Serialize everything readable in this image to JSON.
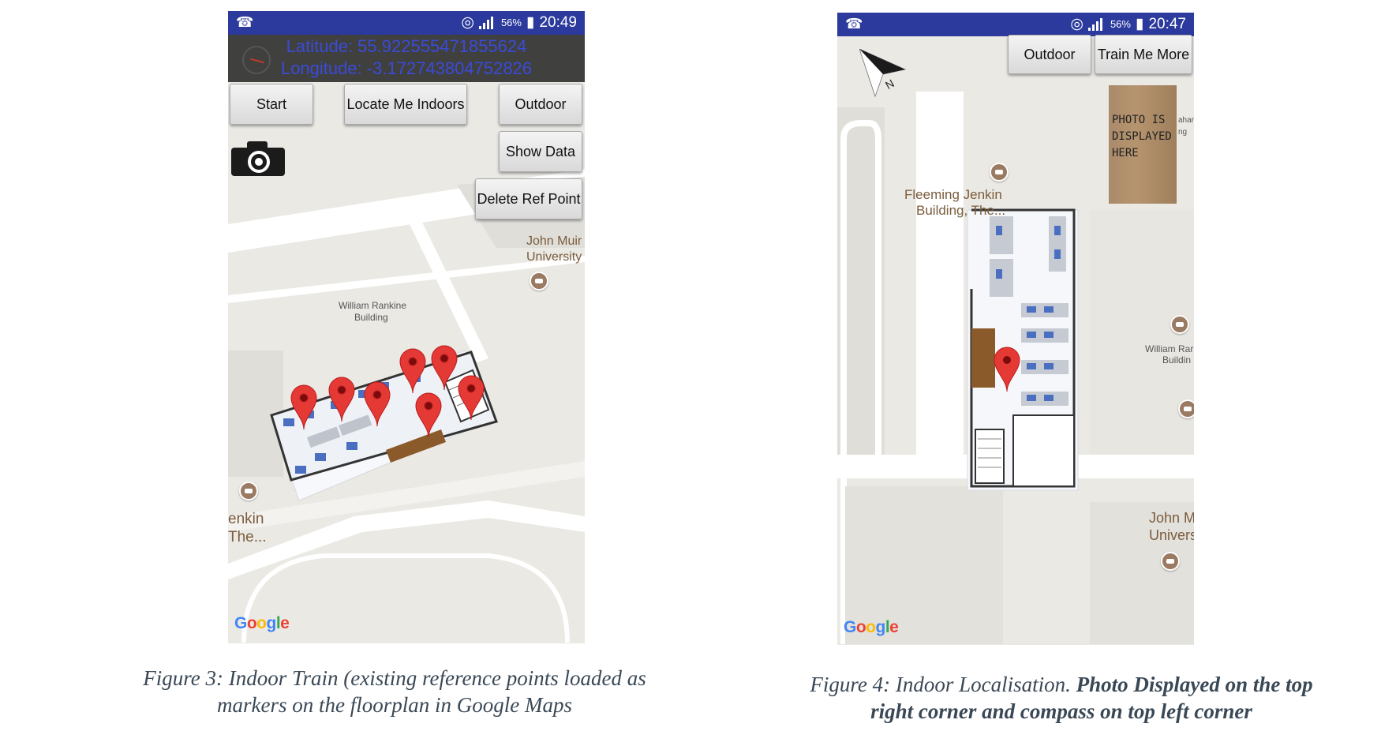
{
  "figure3": {
    "status": {
      "left_icon": "notification-icon",
      "battery_pct": "56%",
      "time": "20:49"
    },
    "latitude": "Latitude: 55.922555471855624",
    "longitude": "Longitude: -3.172743804752826",
    "buttons": {
      "start": "Start",
      "locate_indoors": "Locate Me Indoors",
      "outdoor": "Outdoor",
      "show_data": "Show Data",
      "delete_ref": "Delete Ref Point"
    },
    "map_labels": {
      "john_muir_1": "John Muir",
      "john_muir_2": "University",
      "rankine_1": "William Rankine",
      "rankine_2": "Building",
      "jenkin_1": "enkin",
      "jenkin_2": "The..."
    },
    "google": [
      "G",
      "o",
      "o",
      "g",
      "l",
      "e"
    ],
    "caption_line1": "Figure 3: Indoor Train (existing reference points loaded as",
    "caption_line2": "markers on the floorplan in Google Maps"
  },
  "figure4": {
    "status": {
      "left_icon": "notification-icon",
      "battery_pct": "56%",
      "time": "20:47"
    },
    "buttons": {
      "outdoor": "Outdoor",
      "train_more": "Train Me More"
    },
    "photo_text": [
      "PHOTO IS",
      "DISPLAYED",
      "HERE"
    ],
    "photo_side_text": [
      "ahar",
      "ng"
    ],
    "compass_letter": "N",
    "map_labels": {
      "fleeming_1": "Fleeming Jenkin",
      "fleeming_2": "Building, The...",
      "rankine_1": "William Rar",
      "rankine_2": "Buildin",
      "john_1": "John M",
      "john_2": "Univers"
    },
    "google": [
      "G",
      "o",
      "o",
      "g",
      "l",
      "e"
    ],
    "caption_plain": "Figure 4: Indoor Localisation.",
    "caption_bold1": "Photo Displayed on the top",
    "caption_bold2": "right corner and compass on top left corner"
  },
  "colors": {
    "status_bar": "#2b3a9c",
    "map_bg": "#ebe9e4",
    "marker": "#e53935",
    "coord_text": "#3a4bd9"
  }
}
